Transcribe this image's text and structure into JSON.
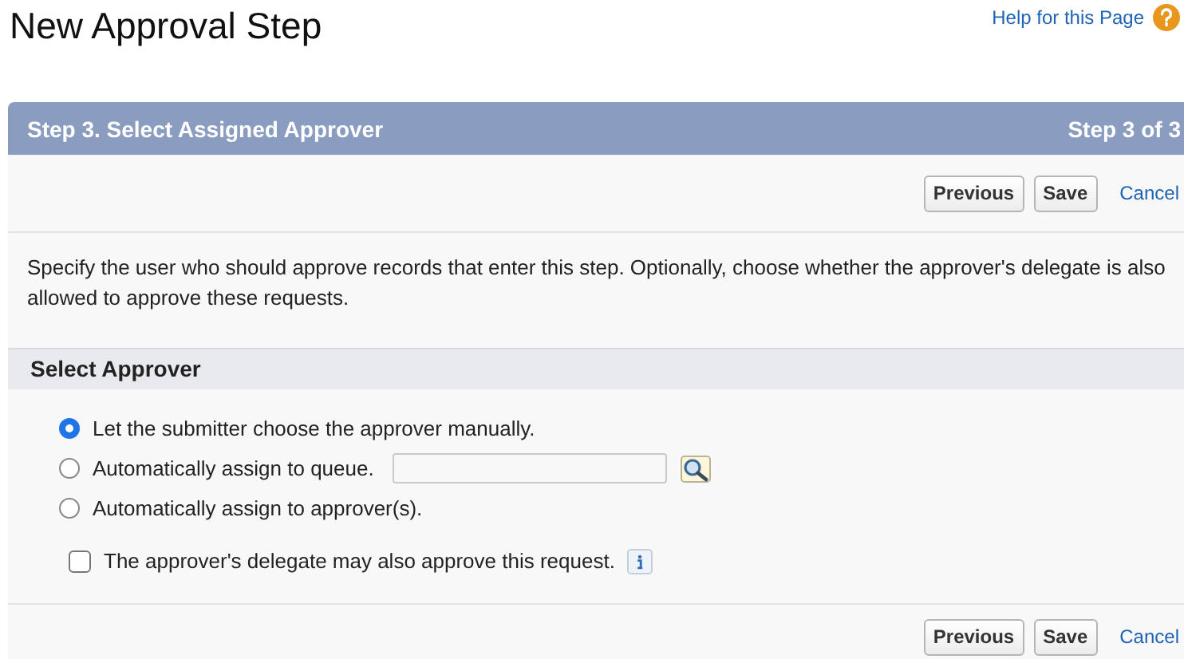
{
  "page": {
    "title": "New Approval Step",
    "help_link": "Help for this Page"
  },
  "step_header": {
    "title": "Step 3. Select Assigned Approver",
    "progress": "Step 3 of 3"
  },
  "top_buttons": [
    "Previous",
    "Save"
  ],
  "top_cancel": "Cancel",
  "description": "Specify the user who should approve records that enter this step. Optionally, choose whether the approver's delegate is also allowed to approve these requests.",
  "section": {
    "title": "Select Approver"
  },
  "options": [
    {
      "label": "Let the submitter choose the approver manually.",
      "selected": true,
      "kind": "plain"
    },
    {
      "label": "Automatically assign to queue.",
      "selected": false,
      "kind": "lookup"
    },
    {
      "label": "Automatically assign to approver(s).",
      "selected": false,
      "kind": "plain"
    }
  ],
  "delegate": {
    "label": "The approver's delegate may also approve this request.",
    "checked": false
  },
  "bottom_buttons": [
    "Previous",
    "Save"
  ],
  "bottom_cancel": "Cancel"
}
